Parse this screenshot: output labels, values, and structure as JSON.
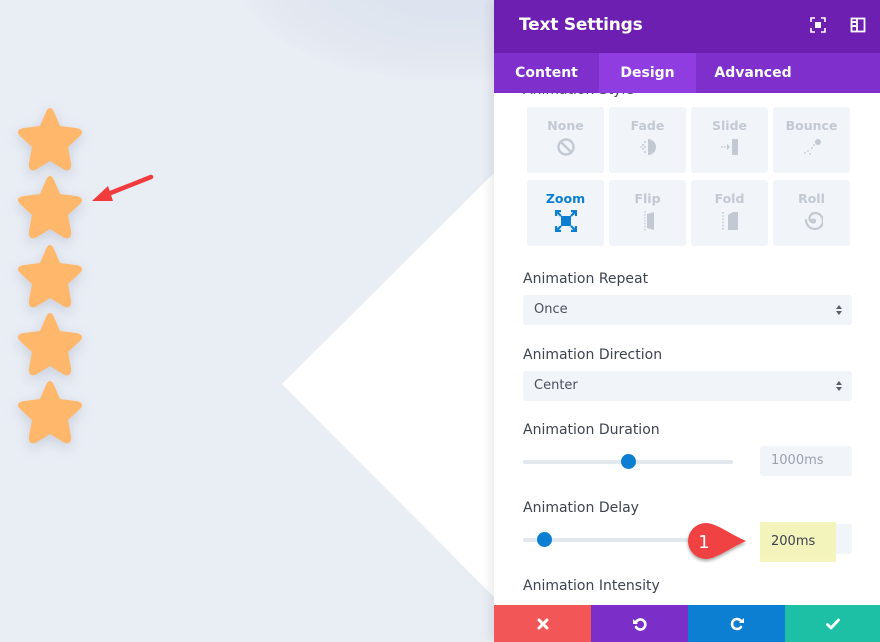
{
  "canvas": {
    "stars": [
      {
        "name": "star-1"
      },
      {
        "name": "star-2",
        "annotated": true
      },
      {
        "name": "star-3"
      },
      {
        "name": "star-4"
      },
      {
        "name": "star-5"
      }
    ],
    "star_color": "#ffb86b",
    "arrow_color": "#f03c3c",
    "arrow_icon": "arrow-pointer-icon"
  },
  "panel": {
    "title": "Text Settings",
    "header_icons": [
      "expand-icon",
      "sidebar-layout-icon"
    ],
    "header_color": "#6c1fb0",
    "tabs": [
      {
        "label": "Content",
        "active": false
      },
      {
        "label": "Design",
        "active": true
      },
      {
        "label": "Advanced",
        "active": false
      }
    ],
    "cut_off_label": "Animation Style",
    "animation_styles": [
      {
        "label": "None",
        "icon": "none-icon",
        "selected": false
      },
      {
        "label": "Fade",
        "icon": "fade-icon",
        "selected": false
      },
      {
        "label": "Slide",
        "icon": "slide-icon",
        "selected": false
      },
      {
        "label": "Bounce",
        "icon": "bounce-icon",
        "selected": false
      },
      {
        "label": "Zoom",
        "icon": "zoom-icon",
        "selected": true
      },
      {
        "label": "Flip",
        "icon": "flip-icon",
        "selected": false
      },
      {
        "label": "Fold",
        "icon": "fold-icon",
        "selected": false
      },
      {
        "label": "Roll",
        "icon": "roll-icon",
        "selected": false
      }
    ],
    "animation_repeat": {
      "label": "Animation Repeat",
      "value": "Once"
    },
    "animation_direction": {
      "label": "Animation Direction",
      "value": "Center"
    },
    "animation_duration": {
      "label": "Animation Duration",
      "value": "1000ms",
      "slider_fraction": 0.5
    },
    "animation_delay": {
      "label": "Animation Delay",
      "value": "200ms",
      "slider_fraction": 0.1
    },
    "animation_intensity": {
      "label": "Animation Intensity"
    },
    "annotation_badge": {
      "text": "1",
      "color": "#f04343"
    },
    "footer": {
      "buttons": [
        {
          "name": "discard",
          "icon": "close-icon",
          "color": "#f25656"
        },
        {
          "name": "undo",
          "icon": "undo-icon",
          "color": "#7b2ec8"
        },
        {
          "name": "redo",
          "icon": "redo-icon",
          "color": "#0c7fd2"
        },
        {
          "name": "save",
          "icon": "check-icon",
          "color": "#1ec0a5"
        }
      ]
    }
  }
}
